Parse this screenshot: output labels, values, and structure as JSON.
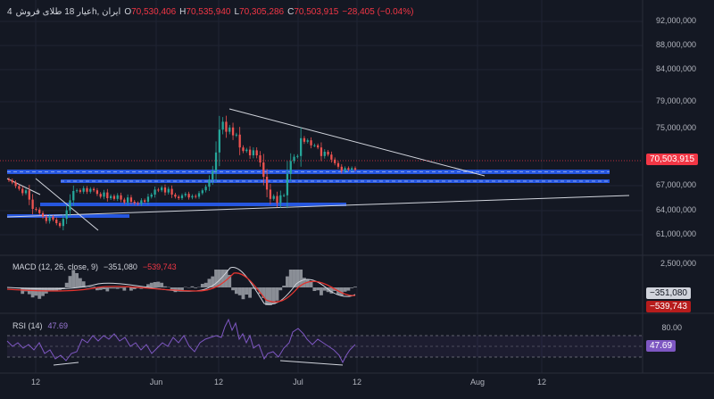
{
  "symbol": {
    "timeframe": "4",
    "name": "عیار 18 طلای فروش‎h, ایران",
    "open_label": "O",
    "open": "70,530,406",
    "high_label": "H",
    "high": "70,535,940",
    "low_label": "L",
    "low": "70,305,286",
    "close_label": "C",
    "close": "70,503,915",
    "change": "−28,405 (−0.04%)"
  },
  "colors": {
    "up": "#26a69a",
    "down": "#ef5350",
    "accent_red": "#f23645",
    "blue_zone": "#2962ff",
    "rsi": "#7e57c2",
    "macd_line": "#d1d4dc",
    "signal_line": "#e3342f"
  },
  "price_axis": {
    "ticks": [
      "92,000,000",
      "88,000,000",
      "84,000,000",
      "79,000,000",
      "75,000,000",
      "67,000,000",
      "64,000,000",
      "61,000,000"
    ],
    "current_price": "70,503,915"
  },
  "macd": {
    "label": "MACD (12, 26, close, 9)",
    "value1": "−351,080",
    "value2": "−539,743",
    "axis_tick": "2,500,000",
    "tag1": "−351,080",
    "tag2": "−539,743"
  },
  "rsi": {
    "label": "RSI (14)",
    "value": "47.69",
    "axis_tick": "80.00",
    "tag": "47.69"
  },
  "time_axis": {
    "labels": [
      "12",
      "Jun",
      "12",
      "Jul",
      "12",
      "Aug",
      "12"
    ]
  },
  "chart_data": {
    "type": "candlestick",
    "x_labels": [
      "12",
      "Jun",
      "12",
      "Jul",
      "12",
      "Aug",
      "12"
    ],
    "ylim": [
      59000000,
      93000000
    ],
    "close": [
      69000000,
      68700000,
      68200000,
      67800000,
      67200000,
      67600000,
      66300000,
      65000000,
      64900000,
      64400000,
      63900000,
      63300000,
      63900000,
      63500000,
      63000000,
      62600000,
      63600000,
      64800000,
      66200000,
      67500000,
      67600000,
      67400000,
      67900000,
      67400000,
      67800000,
      67600000,
      67100000,
      66700000,
      67300000,
      66500000,
      66800000,
      66400000,
      66900000,
      66300000,
      65900000,
      66600000,
      66000000,
      65800000,
      65700000,
      66200000,
      66000000,
      66700000,
      67000000,
      67700000,
      67600000,
      68000000,
      67300000,
      67800000,
      67000000,
      66700000,
      66500000,
      66900000,
      67100000,
      66600000,
      66800000,
      66700000,
      67200000,
      67600000,
      68100000,
      69100000,
      70300000,
      72900000,
      76100000,
      77200000,
      75800000,
      76400000,
      75300000,
      75400000,
      73600000,
      73100000,
      73300000,
      72500000,
      73200000,
      72500000,
      71500000,
      69500000,
      67700000,
      66400000,
      66800000,
      65800000,
      66900000,
      66900000,
      69900000,
      71700000,
      72300000,
      72400000,
      74900000,
      74400000,
      74600000,
      73900000,
      73900000,
      73600000,
      72400000,
      73000000,
      72600000,
      71900000,
      71400000,
      70900000,
      70300000,
      70700000,
      70500000,
      70700000,
      70500000
    ],
    "annotations": [
      "descending trendline",
      "rising support line",
      "blue horizontal zones",
      "dotted current price line"
    ]
  }
}
